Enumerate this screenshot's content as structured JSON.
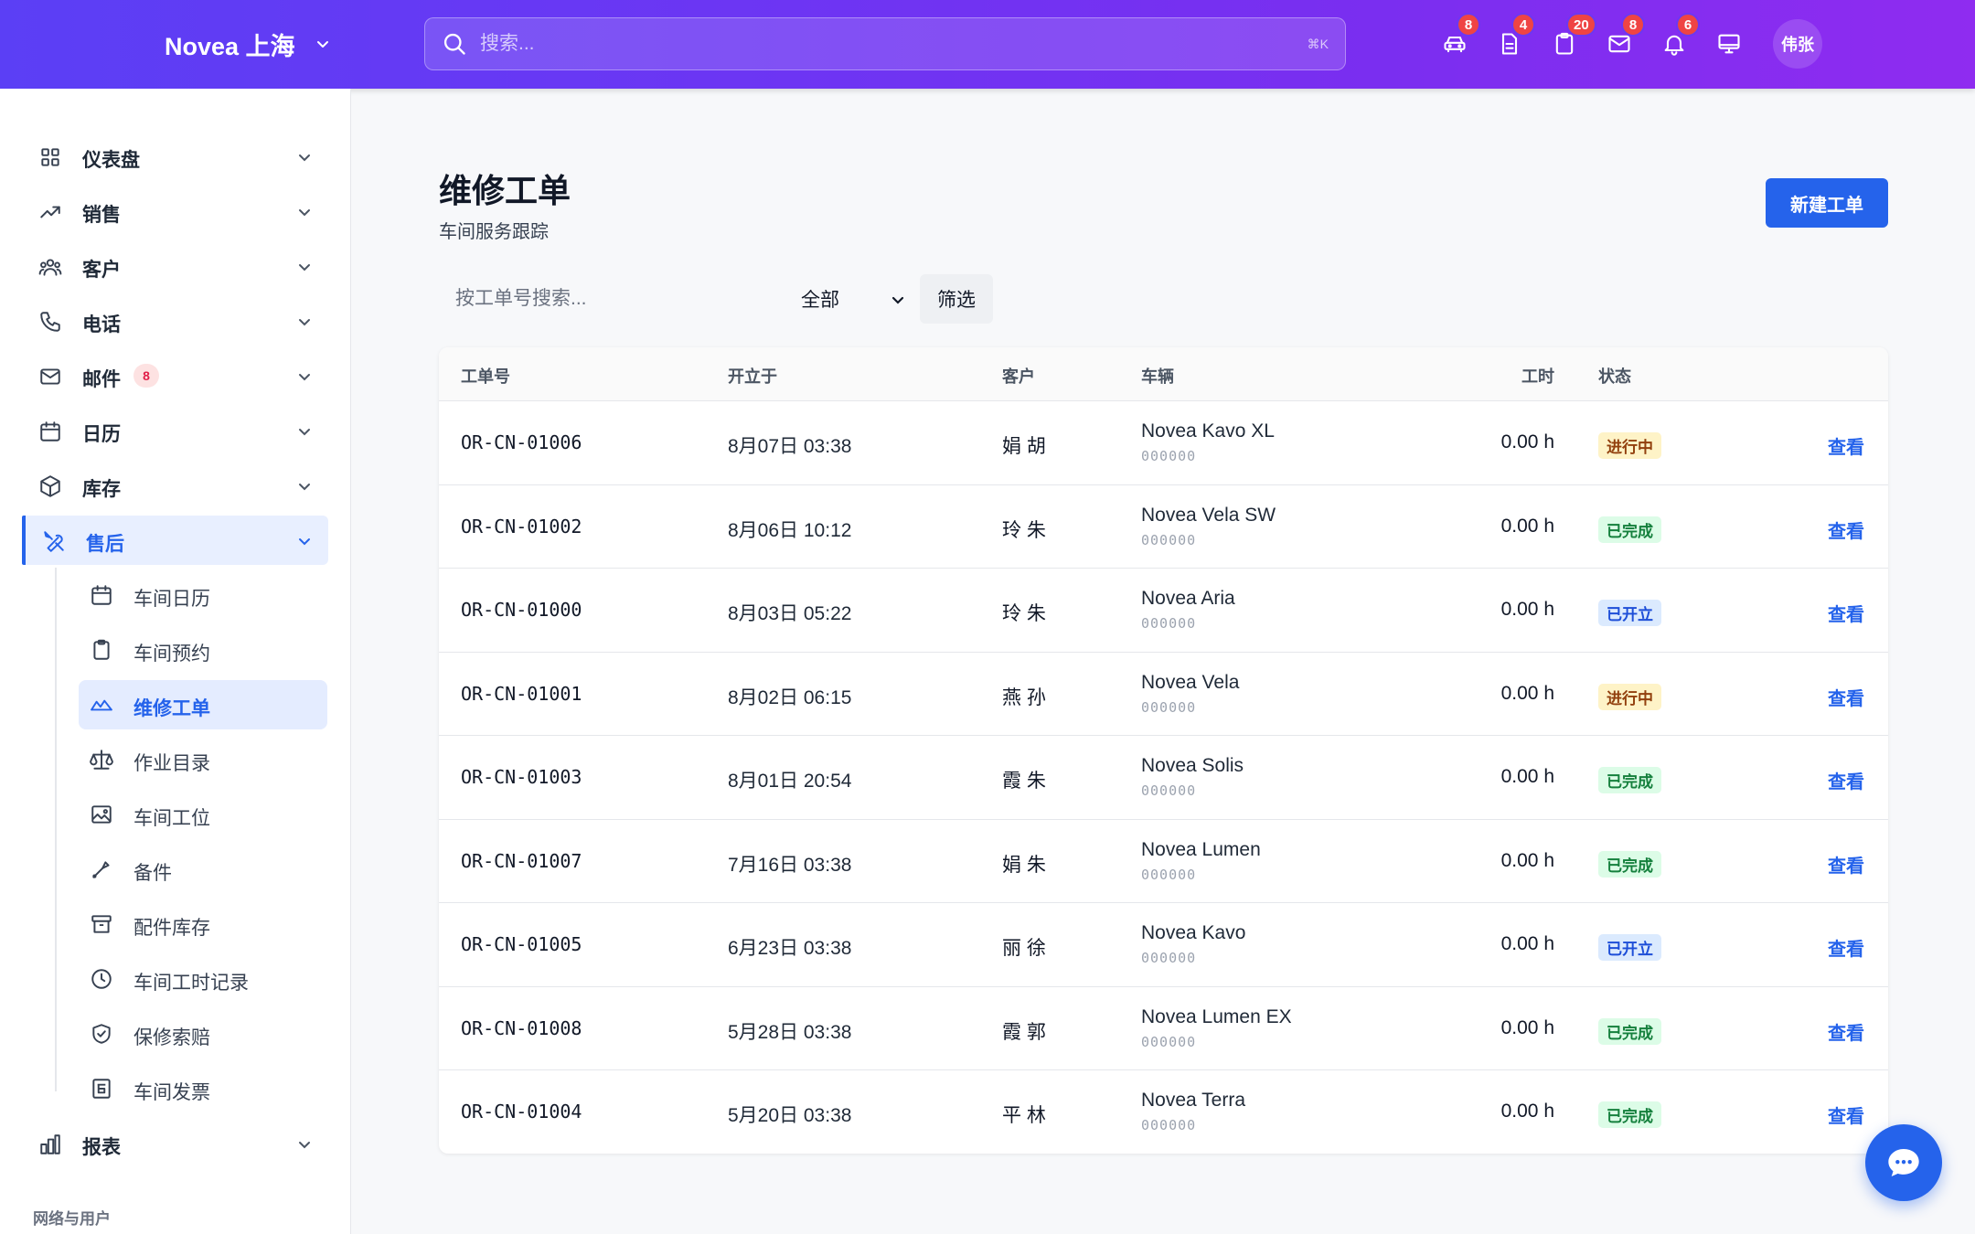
{
  "brand": {
    "name": "Novea 上海"
  },
  "search": {
    "placeholder": "搜索...",
    "shortcut": "⌘K"
  },
  "top_icons": [
    {
      "name": "car-icon",
      "badge": "8"
    },
    {
      "name": "document-icon",
      "badge": "4"
    },
    {
      "name": "clipboard-icon",
      "badge": "20"
    },
    {
      "name": "mail-icon",
      "badge": "8"
    },
    {
      "name": "bell-icon",
      "badge": "6"
    },
    {
      "name": "monitor-icon",
      "badge": ""
    }
  ],
  "user": {
    "avatar_text": "伟张"
  },
  "sidebar": {
    "items": [
      {
        "label": "仪表盘"
      },
      {
        "label": "销售"
      },
      {
        "label": "客户"
      },
      {
        "label": "电话"
      },
      {
        "label": "邮件",
        "count": "8"
      },
      {
        "label": "日历"
      },
      {
        "label": "库存"
      },
      {
        "label": "售后"
      },
      {
        "label": "报表"
      }
    ],
    "sub_items": [
      {
        "label": "车间日历"
      },
      {
        "label": "车间预约"
      },
      {
        "label": "维修工单"
      },
      {
        "label": "作业目录"
      },
      {
        "label": "车间工位"
      },
      {
        "label": "备件"
      },
      {
        "label": "配件库存"
      },
      {
        "label": "车间工时记录"
      },
      {
        "label": "保修索赔"
      },
      {
        "label": "车间发票"
      }
    ],
    "section_title": "网络与用户"
  },
  "page": {
    "title": "维修工单",
    "subtitle": "车间服务跟踪",
    "new_button": "新建工单"
  },
  "filters": {
    "search_placeholder": "按工单号搜索...",
    "status_select": "全部",
    "filter_button": "筛选"
  },
  "table": {
    "headers": {
      "id": "工单号",
      "opened": "开立于",
      "customer": "客户",
      "vehicle": "车辆",
      "hours": "工时",
      "status": "状态"
    },
    "rows": [
      {
        "id": "OR-CN-01006",
        "opened": "8月07日 03:38",
        "customer": "娟 胡",
        "vehicle": "Novea Kavo XL",
        "vin": "000000",
        "hours": "0.00 h",
        "status": "进行中",
        "action": "查看"
      },
      {
        "id": "OR-CN-01002",
        "opened": "8月06日 10:12",
        "customer": "玲 朱",
        "vehicle": "Novea Vela SW",
        "vin": "000000",
        "hours": "0.00 h",
        "status": "已完成",
        "action": "查看"
      },
      {
        "id": "OR-CN-01000",
        "opened": "8月03日 05:22",
        "customer": "玲 朱",
        "vehicle": "Novea Aria",
        "vin": "000000",
        "hours": "0.00 h",
        "status": "已开立",
        "action": "查看"
      },
      {
        "id": "OR-CN-01001",
        "opened": "8月02日 06:15",
        "customer": "燕 孙",
        "vehicle": "Novea Vela",
        "vin": "000000",
        "hours": "0.00 h",
        "status": "进行中",
        "action": "查看"
      },
      {
        "id": "OR-CN-01003",
        "opened": "8月01日 20:54",
        "customer": "霞 朱",
        "vehicle": "Novea Solis",
        "vin": "000000",
        "hours": "0.00 h",
        "status": "已完成",
        "action": "查看"
      },
      {
        "id": "OR-CN-01007",
        "opened": "7月16日 03:38",
        "customer": "娟 朱",
        "vehicle": "Novea Lumen",
        "vin": "000000",
        "hours": "0.00 h",
        "status": "已完成",
        "action": "查看"
      },
      {
        "id": "OR-CN-01005",
        "opened": "6月23日 03:38",
        "customer": "丽 徐",
        "vehicle": "Novea Kavo",
        "vin": "000000",
        "hours": "0.00 h",
        "status": "已开立",
        "action": "查看"
      },
      {
        "id": "OR-CN-01008",
        "opened": "5月28日 03:38",
        "customer": "霞 郭",
        "vehicle": "Novea Lumen EX",
        "vin": "000000",
        "hours": "0.00 h",
        "status": "已完成",
        "action": "查看"
      },
      {
        "id": "OR-CN-01004",
        "opened": "5月20日 03:38",
        "customer": "平 林",
        "vehicle": "Novea Terra",
        "vin": "000000",
        "hours": "0.00 h",
        "status": "已完成",
        "action": "查看"
      }
    ]
  },
  "colors": {
    "accent": "#2563eb",
    "topbar_start": "#5b3ff5",
    "topbar_end": "#8f2cf0",
    "badge": "#ef4444"
  }
}
